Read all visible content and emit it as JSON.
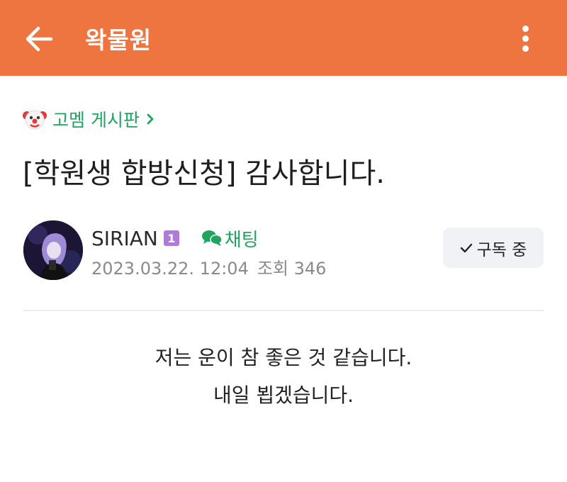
{
  "appbar": {
    "title": "왁물원",
    "back_icon": "arrow-left-icon",
    "menu_icon": "more-vertical-icon",
    "color": "#ee7540"
  },
  "post": {
    "board": "고멤 게시판",
    "board_icon": "clown-face-icon",
    "title": "[학원생 합방신청] 감사합니다.",
    "author": "SIRIAN",
    "author_level": "1",
    "chat_label": "채팅",
    "date": "2023.03.22. 12:04",
    "views_label": "조회 346",
    "subscribe_label": "구독 중",
    "content_lines": [
      "저는 운이 참 좋은 것 같습니다.",
      "내일 뵙겠습니다."
    ]
  },
  "colors": {
    "accent_green": "#1ea55f",
    "level_badge": "#b07ad8"
  }
}
